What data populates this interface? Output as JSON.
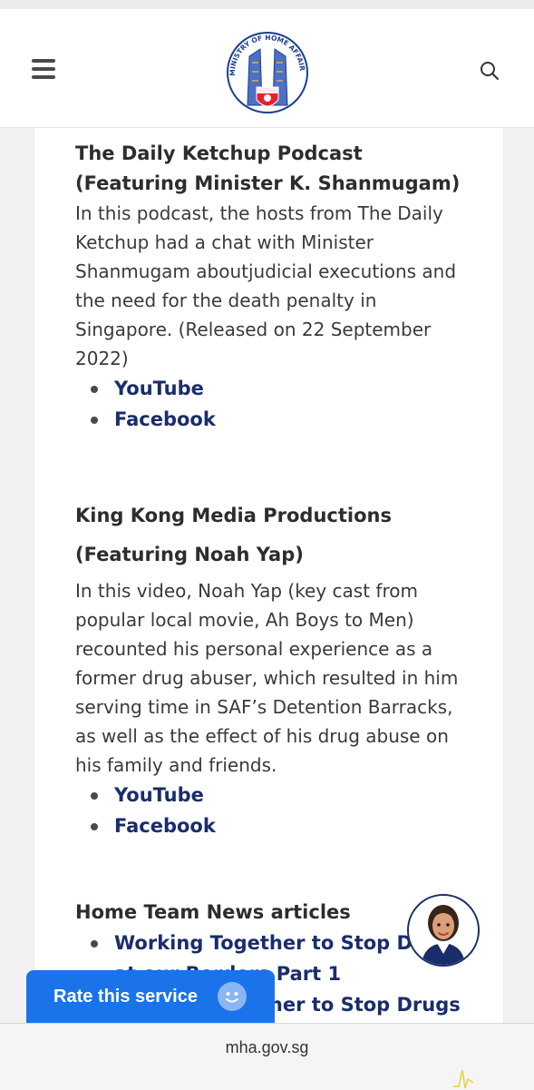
{
  "header": {
    "logo_text": "MINISTRY OF HOME AFFAIRS",
    "menu_icon": "hamburger-menu-icon",
    "search_icon": "search-icon"
  },
  "content": {
    "section1": {
      "title": "The Daily Ketchup Podcast (Featuring Minister K. Shanmugam)",
      "description": "In this podcast, the hosts from The Daily Ketchup had a chat with Minister Shanmugam aboutjudicial executions and the need for the death penalty in Singapore. (Released on 22 September 2022)",
      "links": [
        "YouTube",
        "Facebook"
      ]
    },
    "section2": {
      "title": "King Kong Media Productions (Featuring Noah Yap)",
      "description": "In this video, Noah Yap (key cast from popular local movie, Ah Boys to Men) recounted his personal experience as a former drug abuser, which resulted in him serving time in SAF’s Detention Barracks, as well as the effect of his drug abuse on his family and friends.",
      "links": [
        "YouTube",
        "Facebook"
      ]
    },
    "section3": {
      "title": "Home Team News articles",
      "links": [
        "Working Together to Stop Drugs at our Borders Part 1",
        "Working Together to Stop Drugs at"
      ]
    }
  },
  "rate_button": {
    "label": "Rate this service",
    "icon": "smiley-icon"
  },
  "chat_avatar": {
    "icon": "assistant-avatar-icon"
  },
  "browser": {
    "url": "mha.gov.sg"
  },
  "colors": {
    "link": "#1a2d6b",
    "rate_button": "#1a73e8",
    "heading": "#2d2d2d"
  }
}
